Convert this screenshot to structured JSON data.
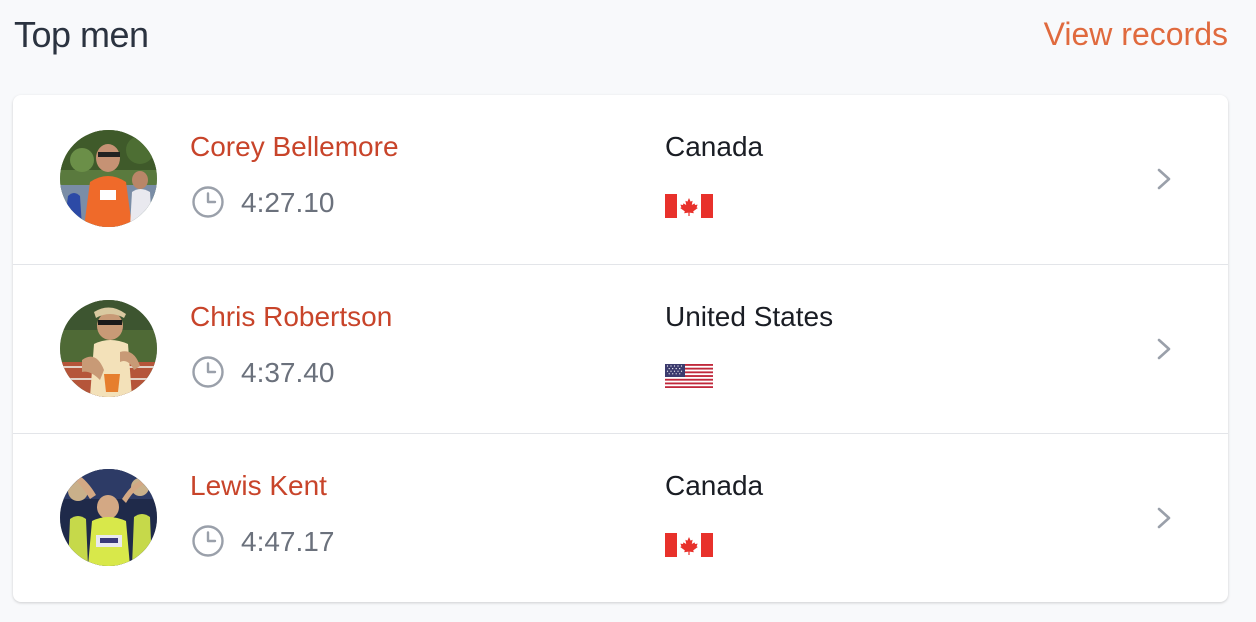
{
  "header": {
    "title": "Top men",
    "view_records_label": "View records"
  },
  "athletes": [
    {
      "name": "Corey Bellemore",
      "time": "4:27.10",
      "country": "Canada",
      "flag": "canada-flag"
    },
    {
      "name": "Chris Robertson",
      "time": "4:37.40",
      "country": "United States",
      "flag": "usa-flag"
    },
    {
      "name": "Lewis Kent",
      "time": "4:47.17",
      "country": "Canada",
      "flag": "canada-flag"
    }
  ],
  "colors": {
    "accent": "#e06a3e",
    "name": "#c8442a",
    "muted": "#6b717c"
  }
}
